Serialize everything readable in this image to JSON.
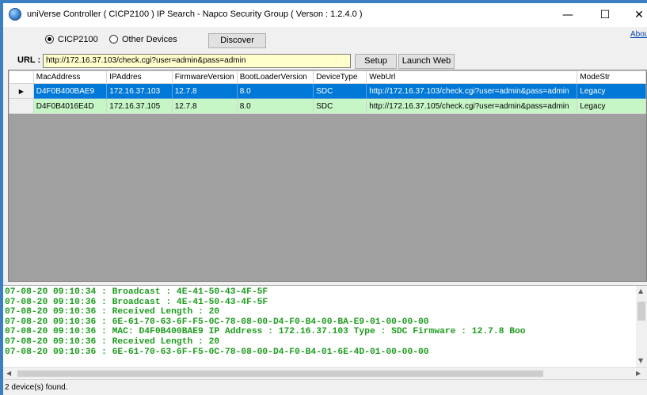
{
  "window": {
    "title": "uniVerse Controller ( CICP2100 ) IP Search -  Napco Security Group ( Verson : 1.2.4.0 )",
    "minimize_glyph": "—",
    "maximize_glyph": "☐",
    "close_glyph": "✕",
    "icon": "globe-icon"
  },
  "about_link": "Abou",
  "mode": {
    "options": [
      {
        "label": "CICP2100",
        "selected": true
      },
      {
        "label": "Other Devices",
        "selected": false
      }
    ]
  },
  "buttons": {
    "discover": "Discover",
    "setup": "Setup",
    "launch_web": "Launch Web"
  },
  "url": {
    "label": "URL :",
    "value": "http://172.16.37.103/check.cgi?user=admin&pass=admin"
  },
  "grid": {
    "columns": [
      "MacAddress",
      "IPAddres",
      "FirmwareVersion",
      "BootLoaderVersion",
      "DeviceType",
      "WebUrl",
      "ModeStr"
    ],
    "rows": [
      {
        "indicator": "▶",
        "selected": true,
        "cells": [
          "D4F0B400BAE9",
          "172.16.37.103",
          "12.7.8",
          "8.0",
          "SDC",
          "http://172.16.37.103/check.cgi?user=admin&pass=admin",
          "Legacy"
        ]
      },
      {
        "indicator": "",
        "selected": false,
        "cells": [
          "D4F0B4016E4D",
          "172.16.37.105",
          "12.7.8",
          "8.0",
          "SDC",
          "http://172.16.37.105/check.cgi?user=admin&pass=admin",
          "Legacy"
        ]
      }
    ],
    "colors": {
      "selected": "#0078d7",
      "normal": "#c6f5c6"
    }
  },
  "log": {
    "color": "#1d9d1d",
    "lines": [
      "07-08-20 09:10:34 : Broadcast : 4E-41-50-43-4F-5F",
      "07-08-20 09:10:36 : Broadcast : 4E-41-50-43-4F-5F",
      "07-08-20 09:10:36 : Received Length : 20",
      "07-08-20 09:10:36 : 6E-61-70-63-6F-F5-0C-78-08-00-D4-F0-B4-00-BA-E9-01-00-00-00",
      "07-08-20 09:10:36 : MAC: D4F0B400BAE9  IP Address : 172.16.37.103  Type : SDC  Firmware : 12.7.8  Boo",
      "07-08-20 09:10:36 : Received Length : 20",
      "07-08-20 09:10:36 : 6E-61-70-63-6F-F5-0C-78-08-00-D4-F0-B4-01-6E-4D-01-00-00-00"
    ]
  },
  "status": "2 device(s) found."
}
